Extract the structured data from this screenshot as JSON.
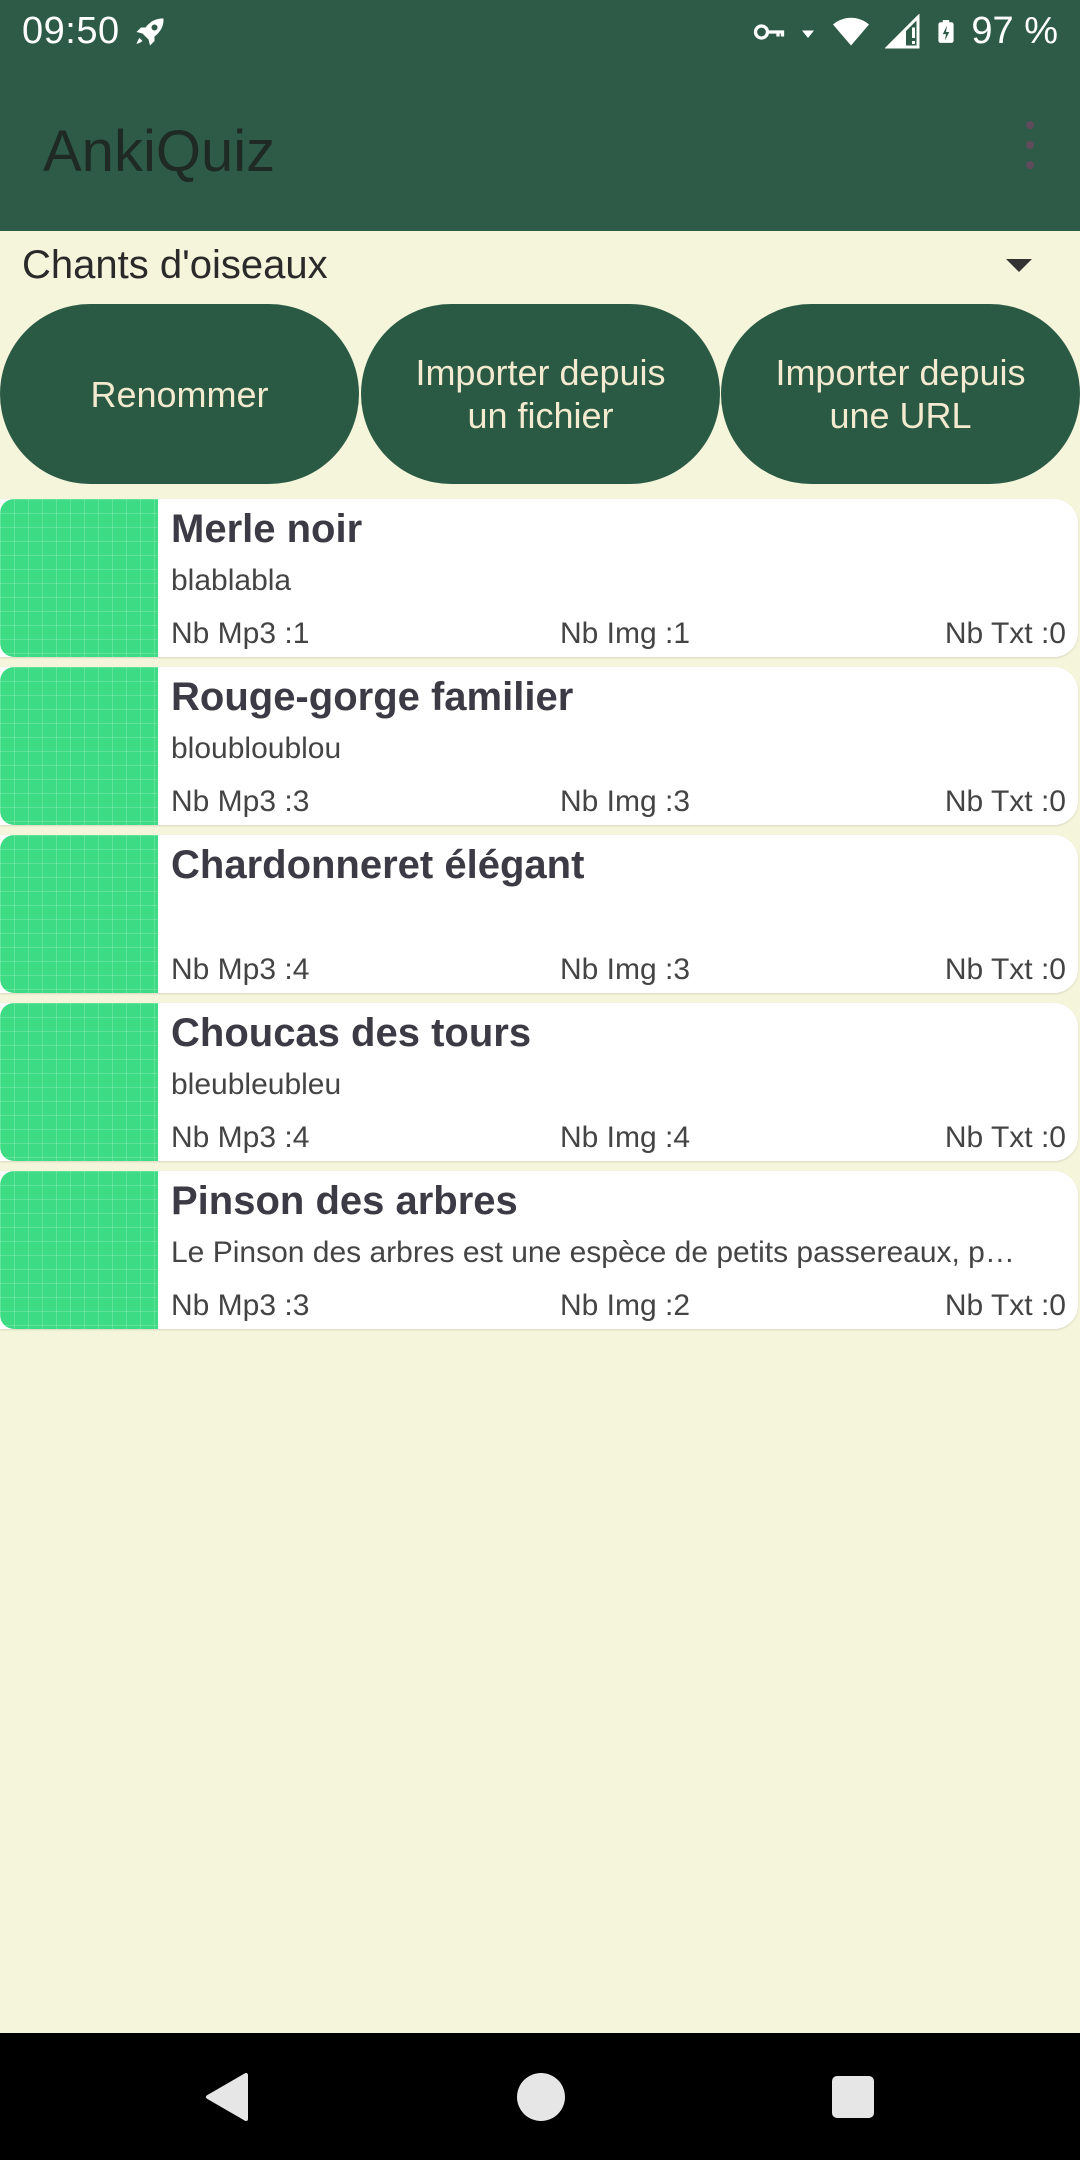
{
  "status_bar": {
    "time": "09:50",
    "battery": "97 %",
    "icons": [
      "rocket-icon",
      "vpn-key-icon",
      "data-arrows-icon",
      "wifi-icon",
      "signal-icon",
      "battery-charging-icon"
    ]
  },
  "app_bar": {
    "title": "AnkiQuiz",
    "menu_icon": "overflow-menu-icon"
  },
  "deck_spinner": {
    "selected": "Chants d'oiseaux"
  },
  "buttons": {
    "rename": "Renommer",
    "import_file": "Importer depuis un fichier",
    "import_url": "Importer depuis une URL"
  },
  "cards": [
    {
      "title": "Merle noir",
      "description": "blablabla",
      "mp3": "Nb Mp3 :1",
      "img": "Nb Img :1",
      "txt": "Nb Txt :0"
    },
    {
      "title": "Rouge-gorge familier",
      "description": "bloubloublou",
      "mp3": "Nb Mp3 :3",
      "img": "Nb Img :3",
      "txt": "Nb Txt :0"
    },
    {
      "title": "Chardonneret élégant",
      "description": "",
      "mp3": "Nb Mp3 :4",
      "img": "Nb Img :3",
      "txt": "Nb Txt :0"
    },
    {
      "title": "Choucas des tours",
      "description": "bleubleubleu",
      "mp3": "Nb Mp3 :4",
      "img": "Nb Img :4",
      "txt": "Nb Txt :0"
    },
    {
      "title": "Pinson des arbres",
      "description": "Le Pinson des arbres est une espèce de petits passereaux, p…",
      "mp3": "Nb Mp3 :3",
      "img": "Nb Img :2",
      "txt": "Nb Txt :0"
    }
  ],
  "colors": {
    "primary": "#2d5b47",
    "background": "#f5f5dc",
    "button_text": "#f3ead0",
    "thumb": "#3ddc84"
  },
  "nav_bar": {
    "icons": [
      "back-icon",
      "home-icon",
      "recents-icon"
    ]
  }
}
